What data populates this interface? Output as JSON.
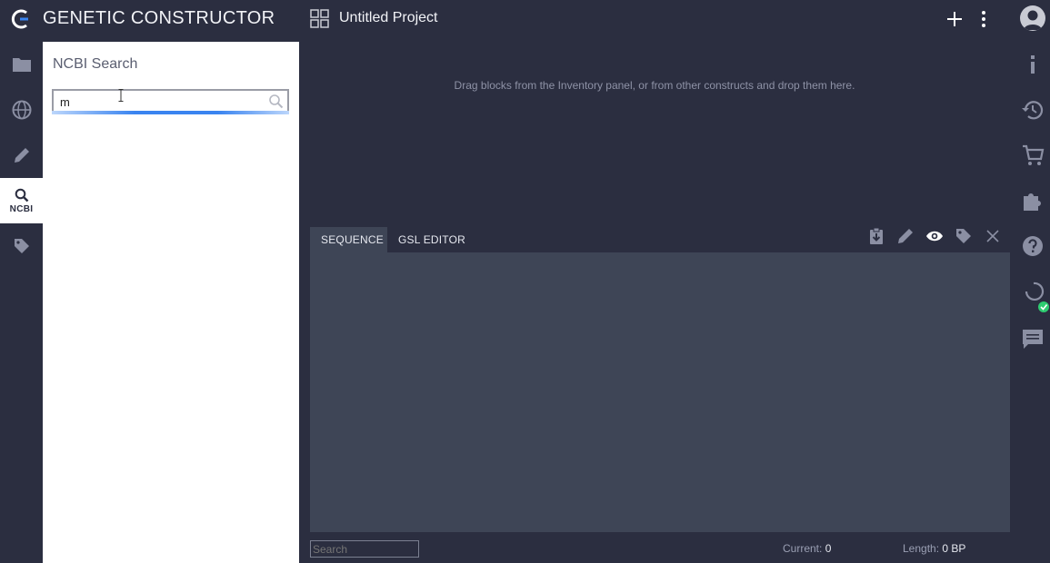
{
  "header": {
    "app_title": "GENETIC CONSTRUCTOR",
    "project_title": "Untitled Project",
    "icons": [
      "logo-icon",
      "grid-icon",
      "plus-icon",
      "kebab-icon",
      "user-icon"
    ]
  },
  "left_rail": {
    "items": [
      {
        "name": "projects",
        "icon": "folder-icon"
      },
      {
        "name": "templates",
        "icon": "globe-icon"
      },
      {
        "name": "sketch",
        "icon": "pencil-icon"
      },
      {
        "name": "ncbi",
        "icon": "search-icon",
        "label": "NCBI",
        "active": true
      },
      {
        "name": "roles",
        "icon": "tag-icon"
      }
    ]
  },
  "inventory": {
    "title": "NCBI Search",
    "search_value": "m",
    "search_placeholder": ""
  },
  "canvas": {
    "hint": "Drag blocks from the Inventory panel, or from other constructs and drop them here."
  },
  "sequence_panel": {
    "tabs": [
      {
        "label": "SEQUENCE",
        "active": true
      },
      {
        "label": "GSL EDITOR",
        "active": false
      }
    ],
    "tools": [
      "clipboard-download-icon",
      "pencil-icon",
      "eye-icon",
      "tag-icon",
      "close-icon"
    ],
    "footer": {
      "search_placeholder": "Search",
      "current_label": "Current:",
      "current_value": "0",
      "length_label": "Length:",
      "length_value": "0 BP"
    }
  },
  "right_rail": {
    "icons": [
      "info-icon",
      "history-icon",
      "cart-icon",
      "puzzle-icon",
      "help-icon",
      "sync-icon",
      "comment-icon"
    ],
    "status_color": "#2ecc71"
  },
  "colors": {
    "background": "#2b2e40",
    "panel": "#3e4556",
    "accent": "#3a84f0"
  }
}
